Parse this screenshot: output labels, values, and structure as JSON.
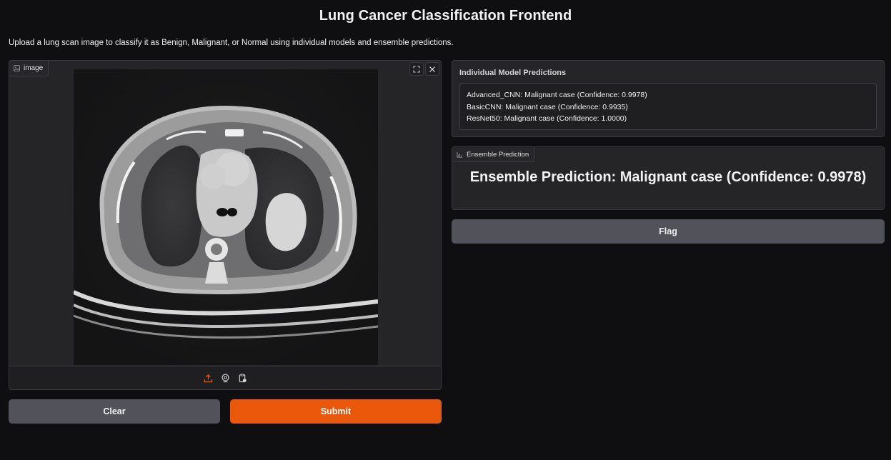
{
  "header": {
    "title": "Lung Cancer Classification Frontend",
    "subtitle": "Upload a lung scan image to classify it as Benign, Malignant, or Normal using individual models and ensemble predictions."
  },
  "image_input": {
    "label": "image",
    "label_icon": "image-icon",
    "corner_buttons": [
      "fullscreen-icon",
      "close-icon"
    ],
    "toolbar_icons": [
      "upload-icon",
      "webcam-icon",
      "clipboard-icon"
    ],
    "accent_color": "#ea580c"
  },
  "buttons": {
    "clear": "Clear",
    "submit": "Submit",
    "flag": "Flag"
  },
  "individual": {
    "title": "Individual Model Predictions",
    "lines": [
      "Advanced_CNN: Malignant case (Confidence: 0.9978)",
      "BasicCNN: Malignant case (Confidence: 0.9935)",
      "ResNet50: Malignant case (Confidence: 1.0000)"
    ]
  },
  "ensemble": {
    "label": "Ensemble Prediction",
    "label_icon": "bar-chart-icon",
    "text": "Ensemble Prediction: Malignant case (Confidence: 0.9978)"
  },
  "colors": {
    "background": "#0f0f11",
    "panel": "#252528",
    "submit": "#ea580c",
    "secondary": "#52525b"
  }
}
